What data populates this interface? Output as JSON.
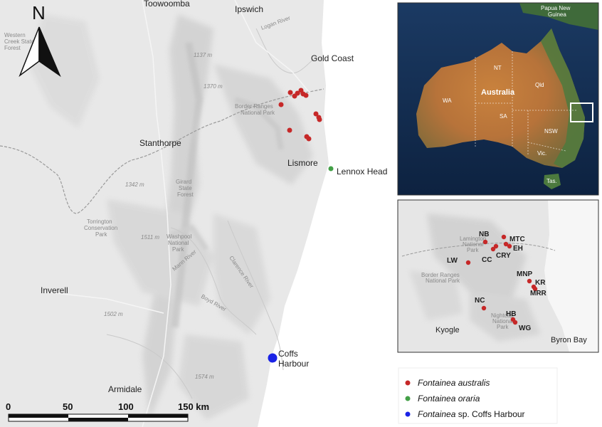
{
  "colors": {
    "australis": "#c62828",
    "oraria": "#43a047",
    "coffs": "#1a23e6",
    "sea": "#fdfdfd",
    "land": "#e9e9e9"
  },
  "north_arrow": {
    "label": "N"
  },
  "places": [
    {
      "id": "toowoomba",
      "text": "Toowoomba"
    },
    {
      "id": "ipswich",
      "text": "Ipswich"
    },
    {
      "id": "gold-coast",
      "text": "Gold Coast"
    },
    {
      "id": "stanthorpe",
      "text": "Stanthorpe"
    },
    {
      "id": "lismore",
      "text": "Lismore"
    },
    {
      "id": "lennox-head",
      "text": "Lennox Head"
    },
    {
      "id": "inverell",
      "text": "Inverell"
    },
    {
      "id": "coffs-harbour-1",
      "text": "Coffs"
    },
    {
      "id": "coffs-harbour-2",
      "text": "Harbour"
    },
    {
      "id": "armidale",
      "text": "Armidale"
    }
  ],
  "minor_labels": [
    {
      "id": "western-creek-1",
      "text": "Western"
    },
    {
      "id": "western-creek-2",
      "text": "Creek State"
    },
    {
      "id": "western-creek-3",
      "text": "Forest"
    },
    {
      "id": "logan-river",
      "text": "Logan River"
    },
    {
      "id": "border-ranges-1",
      "text": "Border Ranges"
    },
    {
      "id": "border-ranges-2",
      "text": "National Park"
    },
    {
      "id": "girard-1",
      "text": "Girard"
    },
    {
      "id": "girard-2",
      "text": "State"
    },
    {
      "id": "girard-3",
      "text": "Forest"
    },
    {
      "id": "torrington-1",
      "text": "Torrington"
    },
    {
      "id": "torrington-2",
      "text": "Conservation"
    },
    {
      "id": "torrington-3",
      "text": "Park"
    },
    {
      "id": "washpool-1",
      "text": "Washpool"
    },
    {
      "id": "washpool-2",
      "text": "National"
    },
    {
      "id": "washpool-3",
      "text": "Park"
    },
    {
      "id": "clarence-river",
      "text": "Clarence River"
    },
    {
      "id": "boyd-river",
      "text": "Boyd River"
    },
    {
      "id": "mann-river",
      "text": "Mann River"
    }
  ],
  "elevations": [
    {
      "id": "e1137",
      "text": "1137 m"
    },
    {
      "id": "e1370",
      "text": "1370 m"
    },
    {
      "id": "e1342",
      "text": "1342 m"
    },
    {
      "id": "e1511",
      "text": "1511 m"
    },
    {
      "id": "e1502",
      "text": "1502 m"
    },
    {
      "id": "e1574",
      "text": "1574 m"
    }
  ],
  "inset_australia": {
    "country_label": "Australia",
    "neighbor_label_1": "Papua New",
    "neighbor_label_2": "Guinea",
    "states": [
      {
        "id": "nt",
        "text": "NT"
      },
      {
        "id": "qld",
        "text": "Qld"
      },
      {
        "id": "wa",
        "text": "WA"
      },
      {
        "id": "sa",
        "text": "SA"
      },
      {
        "id": "nsw",
        "text": "NSW"
      },
      {
        "id": "vic",
        "text": "Vic."
      },
      {
        "id": "tas",
        "text": "Tas."
      }
    ]
  },
  "inset_detail": {
    "sites": [
      "NB",
      "MTC",
      "EH",
      "CRY",
      "CC",
      "LW",
      "MNP",
      "KR",
      "MRR",
      "NC",
      "HB",
      "WG"
    ],
    "towns": [
      {
        "id": "kyogle",
        "text": "Kyogle"
      },
      {
        "id": "byron-bay",
        "text": "Byron Bay"
      }
    ],
    "minor": [
      {
        "id": "lamington-1",
        "text": "Lamington"
      },
      {
        "id": "lamington-2",
        "text": "National"
      },
      {
        "id": "lamington-3",
        "text": "Park"
      },
      {
        "id": "border-1",
        "text": "Border Ranges"
      },
      {
        "id": "border-2",
        "text": "National Park"
      },
      {
        "id": "nightcap-1",
        "text": "Nightcap"
      },
      {
        "id": "nightcap-2",
        "text": "National"
      },
      {
        "id": "nightcap-3",
        "text": "Park"
      }
    ]
  },
  "scale_bar": {
    "ticks": [
      "0",
      "50",
      "100",
      "150 km"
    ]
  },
  "legend": {
    "items": [
      {
        "id": "australis",
        "label": "Fontainea australis",
        "color": "#c62828"
      },
      {
        "id": "oraria",
        "label": "Fontainea oraria",
        "color": "#43a047"
      },
      {
        "id": "coffs",
        "label": "sp. Coffs Harbour",
        "genus": "Fontainea",
        "color": "#1a23e6"
      }
    ]
  }
}
